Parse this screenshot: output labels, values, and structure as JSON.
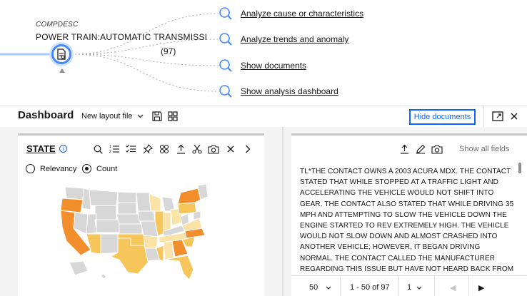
{
  "graph": {
    "field_label": "COMPDESC",
    "field_value": "POWER TRAIN:AUTOMATIC TRANSMISSI",
    "doc_count": "(97)",
    "actions": [
      {
        "label": "Analyze cause or characteristics",
        "icon": "search-icon"
      },
      {
        "label": "Analyze trends and anomaly",
        "icon": "search-icon"
      },
      {
        "label": "Show documents",
        "icon": "search-icon"
      },
      {
        "label": "Show analysis dashboard",
        "icon": "search-icon"
      }
    ]
  },
  "dashboard": {
    "title": "Dashboard",
    "layout_select": "New layout file",
    "hide_documents_label": "Hide documents",
    "icons": [
      "chevron-down-icon",
      "save-icon",
      "grid-icon",
      "popout-icon",
      "close-icon"
    ]
  },
  "state_panel": {
    "title": "STATE",
    "info_glyph": "i",
    "radio_options": [
      {
        "label": "Relevancy",
        "selected": false
      },
      {
        "label": "Count",
        "selected": true
      }
    ],
    "toolbar_icons": [
      "search-icon",
      "sort-list-icon",
      "checklist-icon",
      "pin-icon",
      "link-icon",
      "export-icon",
      "cut-icon",
      "camera-icon",
      "close-icon",
      "chevron-right-icon"
    ],
    "colors": {
      "high": "#f28e2b",
      "mid": "#f6c65b",
      "low": "#fbe3a8",
      "none": "#d7d7d7",
      "border": "#ffffff"
    }
  },
  "document_panel": {
    "show_all_label": "Show all fields",
    "toolbar_icons": [
      "export-icon",
      "edit-icon",
      "camera-icon"
    ],
    "text": "TL*THE CONTACT OWNS A 2003 ACURA MDX. THE CONTACT STATED THAT WHILE STOPPED AT A TRAFFIC LIGHT AND ACCELERATING THE VEHICLE WOULD NOT SHIFT INTO GEAR. THE CONTACT ALSO STATED THAT WHILE DRIVING 35 MPH AND ATTEMPTING TO SLOW THE VEHICLE DOWN THE ENGINE STARTED TO REV EXTREMELY HIGH. THE VEHICLE WOULD NOT SLOW DOWN AND ALMOST CRASHED INTO ANOTHER VEHICLE; HOWEVER, IT BEGAN DRIVING NORMAL. THE CONTACT CALLED THE MANUFACTURER REGARDING THIS ISSUE BUT HAVE NOT HEARD BACK FROM THEM AT THIS TIME. THE",
    "pager": {
      "page_size": "50",
      "range": "1 - 50 of 97",
      "page": "1",
      "prev_glyph": "◀",
      "next_glyph": "▶"
    }
  }
}
